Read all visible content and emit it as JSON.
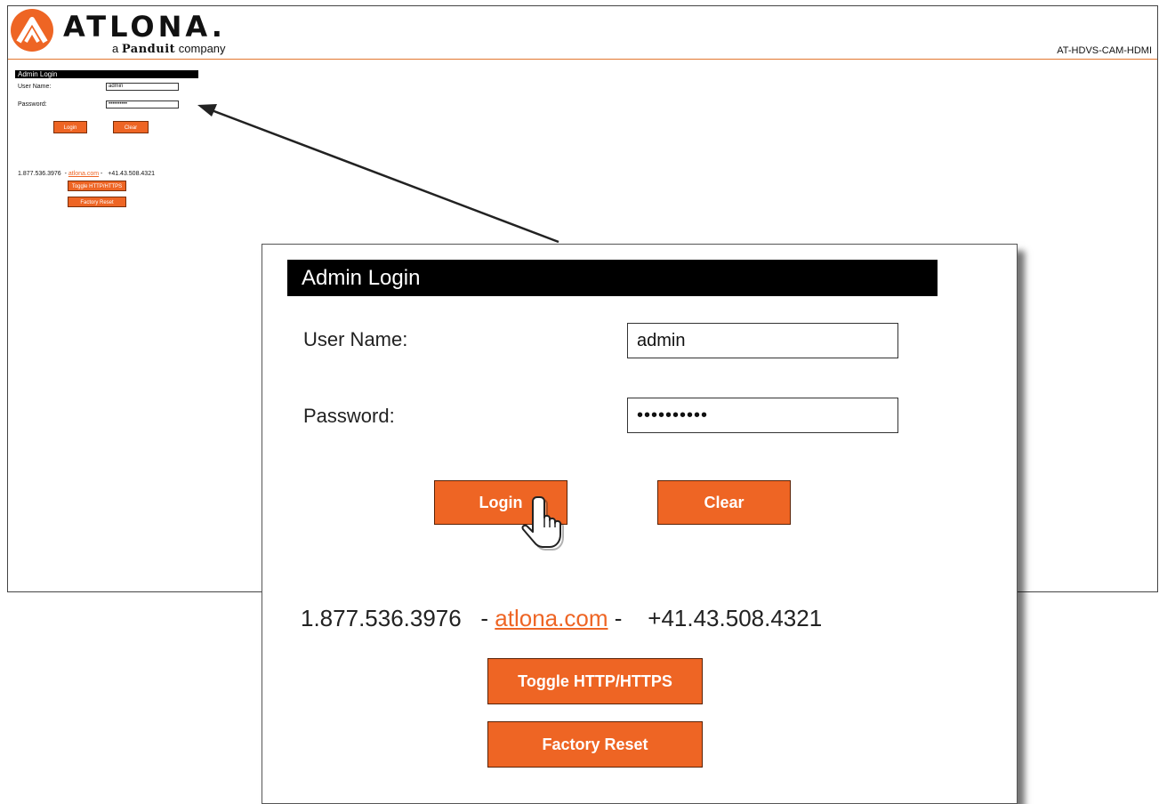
{
  "brand": {
    "name": "ATLONA.",
    "tagline_prefix": "a",
    "tagline_brand": "Panduit",
    "tagline_suffix": "company",
    "accent": "#ee6524"
  },
  "header": {
    "model": "AT-HDVS-CAM-HDMI"
  },
  "login": {
    "title": "Admin Login",
    "username_label": "User Name:",
    "username_value": "admin",
    "password_label": "Password:",
    "password_value": "••••••••••",
    "login_button": "Login",
    "clear_button": "Clear"
  },
  "contact": {
    "phone_us": "1.877.536.3976",
    "sep1": " - ",
    "website": "atlona.com",
    "sep2": " - ",
    "phone_intl": "+41.43.508.4321"
  },
  "actions": {
    "toggle_protocol": "Toggle HTTP/HTTPS",
    "factory_reset": "Factory Reset"
  },
  "icons": [
    "atlona-logo-icon",
    "hand-pointer-cursor-icon",
    "callout-arrow-icon"
  ]
}
